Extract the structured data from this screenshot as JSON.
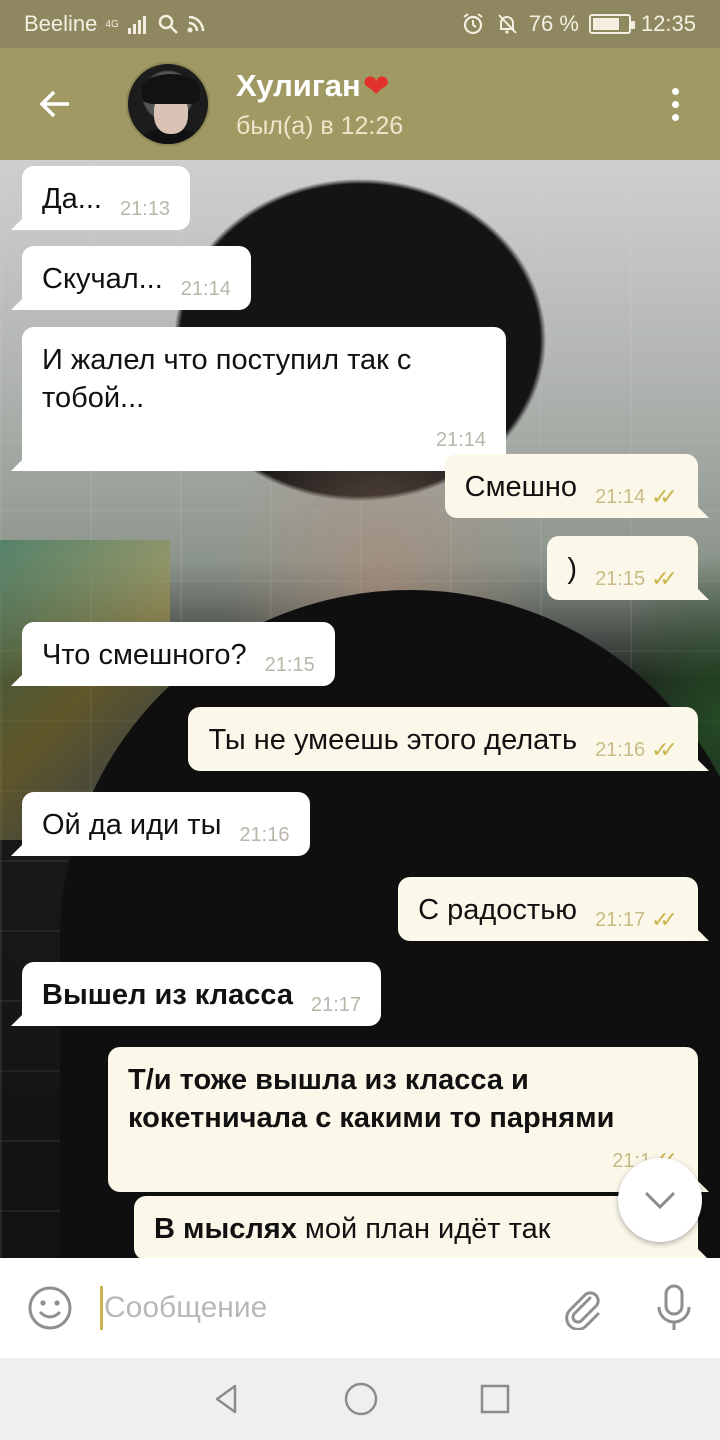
{
  "status_bar": {
    "carrier": "Beeline",
    "network": "4G",
    "battery": "76 %",
    "battery_level": 0.76,
    "time": "12:35"
  },
  "header": {
    "contact_name": "Хулиган",
    "name_emoji": "❤",
    "last_seen": "был(а) в 12:26"
  },
  "messages": [
    {
      "dir": "in",
      "text": "Да...",
      "time": "21:13"
    },
    {
      "dir": "in",
      "text": "Скучал...",
      "time": "21:14"
    },
    {
      "dir": "in",
      "text": "И жалел что поступил так с тобой...",
      "time": "21:14"
    },
    {
      "dir": "out",
      "text": "Смешно",
      "time": "21:14",
      "read": true
    },
    {
      "dir": "out",
      "text": ")",
      "time": "21:15",
      "read": true
    },
    {
      "dir": "in",
      "text": "Что смешного?",
      "time": "21:15"
    },
    {
      "dir": "out",
      "text": "Ты не умеешь этого делать",
      "time": "21:16",
      "read": true
    },
    {
      "dir": "in",
      "text": "Ой да иди ты",
      "time": "21:16"
    },
    {
      "dir": "out",
      "text": "С радостью",
      "time": "21:17",
      "read": true
    },
    {
      "dir": "in",
      "text": "Вышел из класса",
      "time": "21:17",
      "bold": true
    },
    {
      "dir": "out",
      "text": "Т/и тоже вышла из класса и кокетничала с какими то парнями",
      "time": "21:1",
      "bold": true,
      "read": true
    },
    {
      "dir": "out",
      "text_bold": "В мыслях",
      "text_rest": " мой план идёт так"
    }
  ],
  "input": {
    "placeholder": "Сообщение"
  },
  "colors": {
    "header": "#a09963",
    "status_bar": "#8e8760",
    "outgoing_bubble": "#fbf8ea",
    "incoming_bubble": "#ffffff",
    "check_marks": "#cbb64e"
  },
  "icons": [
    "back-arrow-icon",
    "menu-dots-icon",
    "emoji-icon",
    "attach-icon",
    "mic-icon",
    "chevron-down-icon",
    "nav-back-icon",
    "nav-home-icon",
    "nav-recents-icon"
  ]
}
